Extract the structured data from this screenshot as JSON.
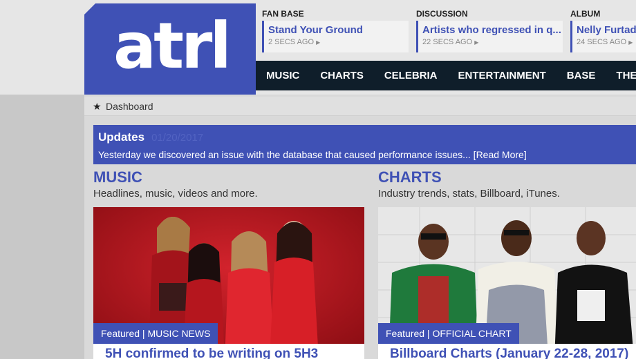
{
  "logo": {
    "text": "atrl"
  },
  "tickers": [
    {
      "category": "FAN BASE",
      "title": "Stand Your Ground",
      "time": "2 SECS AGO"
    },
    {
      "category": "DISCUSSION",
      "title": "Artists who regressed in q...",
      "time": "22 SECS AGO"
    },
    {
      "category": "ALBUM",
      "title": "Nelly Furtado",
      "time": "24 SECS AGO"
    }
  ],
  "nav": [
    "MUSIC",
    "CHARTS",
    "CELEBRIA",
    "ENTERTAINMENT",
    "BASE",
    "THE LOU"
  ],
  "breadcrumb": {
    "label": "Dashboard",
    "icon": "star-icon"
  },
  "updates": {
    "title": "Updates",
    "date": "01/20/2017",
    "message": "Yesterday we discovered an issue with the database that caused performance issues... [Read More]"
  },
  "sections": [
    {
      "title": "MUSIC",
      "description": "Headlines, music, videos and more.",
      "tag": "Featured | MUSIC NEWS",
      "headline": "5H confirmed to be writing on 5H3"
    },
    {
      "title": "CHARTS",
      "description": "Industry trends, stats, Billboard, iTunes.",
      "tag": "Featured | OFFICIAL CHART",
      "headline": "Billboard Charts (January 22-28, 2017)"
    }
  ],
  "colors": {
    "brand": "#3f51b5",
    "nav_bg": "#0f1e2a"
  }
}
